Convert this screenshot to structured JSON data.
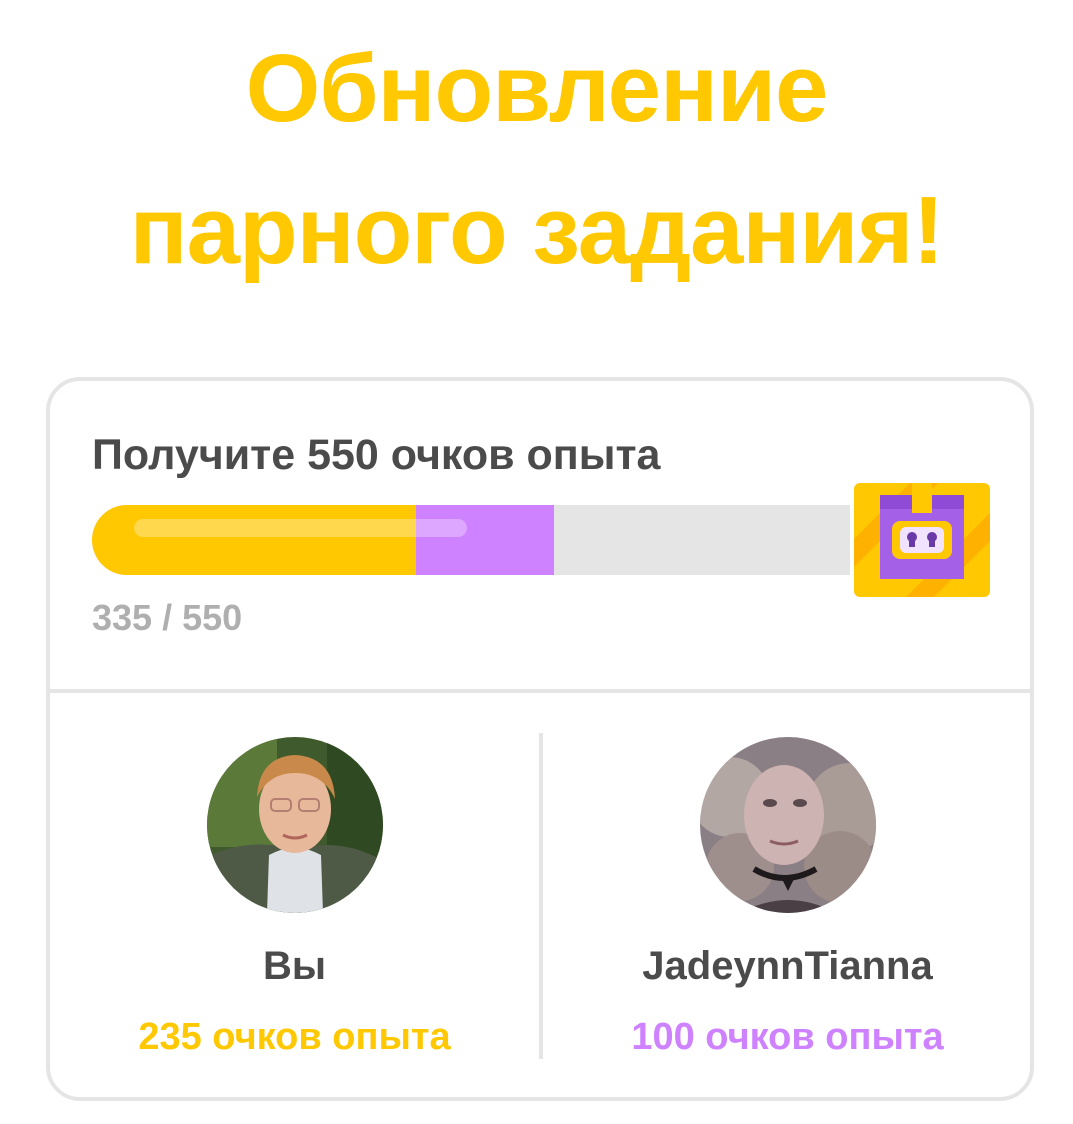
{
  "header": {
    "title_line1": "Обновление",
    "title_line2": "парного задания!"
  },
  "quest": {
    "goal_label": "Получите 550 очков опыта",
    "current": 335,
    "target": 550,
    "progress_text": "335 / 550",
    "reward_icon": "treasure-chest-icon"
  },
  "members": [
    {
      "name": "Вы",
      "xp": 235,
      "xp_label": "235 очков опыта",
      "color": "#ffc800",
      "avatar": "user-avatar-photo"
    },
    {
      "name": "JadeynnTianna",
      "xp": 100,
      "xp_label": "100 очков опыта",
      "color": "#ce82ff",
      "avatar": "friend-avatar-photo"
    }
  ],
  "colors": {
    "accent_yellow": "#ffc800",
    "accent_purple": "#ce82ff",
    "track_gray": "#e5e5e5",
    "text_dark": "#4b4b4b",
    "text_muted": "#afafaf"
  }
}
